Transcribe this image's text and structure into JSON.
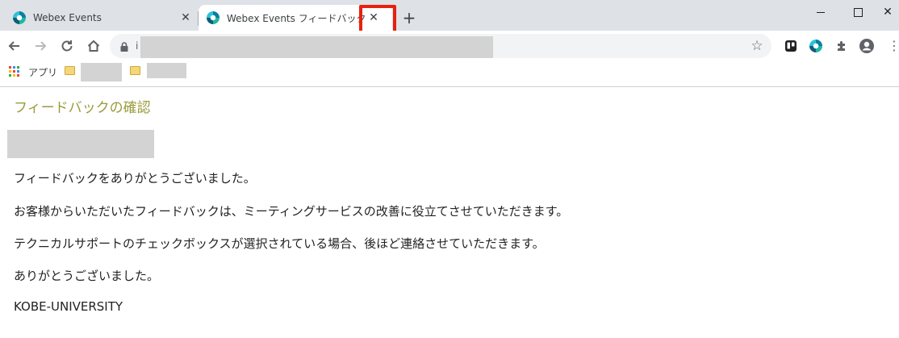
{
  "browser": {
    "tabs": [
      {
        "title": "Webex Events",
        "close_glyph": "✕",
        "icon": "webex-logo-icon",
        "active": false
      },
      {
        "title": "Webex Events フィードバック",
        "close_glyph": "✕",
        "icon": "webex-logo-icon",
        "active": true
      }
    ],
    "new_tab_glyph": "+",
    "window_close_glyph": "✕",
    "toolbar": {
      "address_hint": "i",
      "star_glyph": "☆",
      "menu_glyph": "⋮"
    },
    "bookmarks": {
      "apps_label": "アプリ"
    },
    "colors": {
      "highlight": "#e8200f",
      "heading": "#9a9a3c",
      "tab_strip": "#dee1e6"
    }
  },
  "page": {
    "heading": "フィードバックの確認",
    "paragraphs": [
      "フィードバックをありがとうございました。",
      "お客様からいただいたフィードバックは、ミーティングサービスの改善に役立てさせていただきます。",
      "テクニカルサポートのチェックボックスが選択されている場合、後ほど連絡させていただきます。",
      "ありがとうございました。",
      "KOBE-UNIVERSITY"
    ]
  }
}
